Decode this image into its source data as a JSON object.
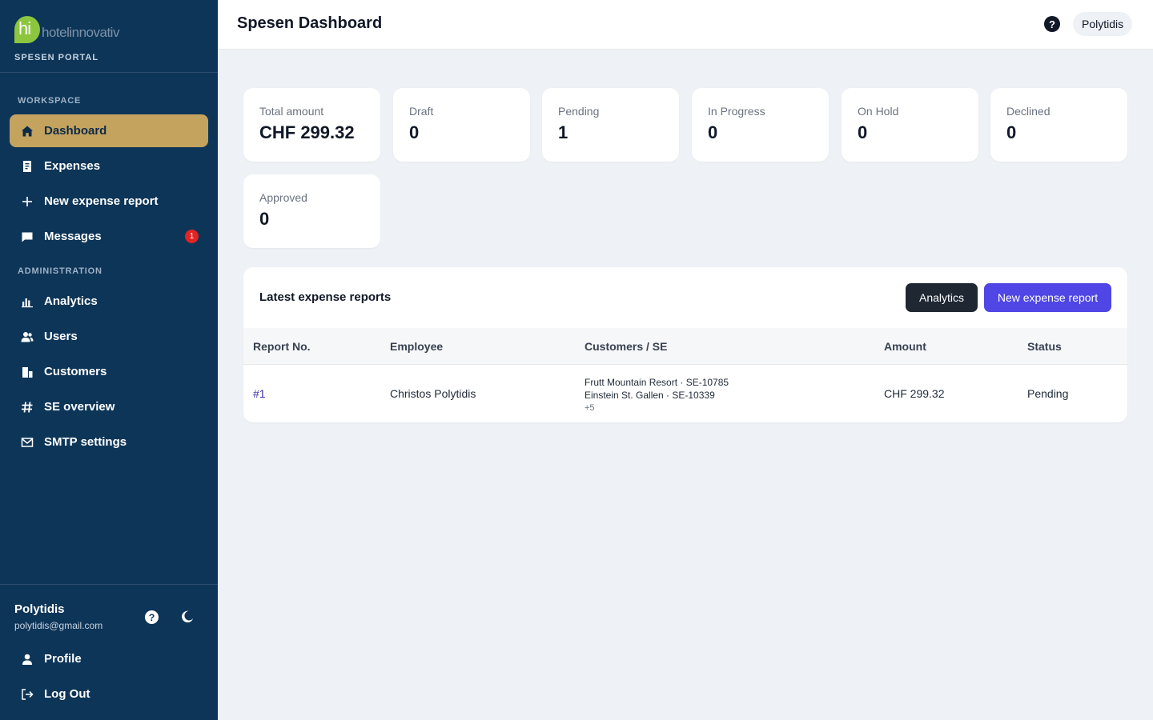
{
  "brand": {
    "logo_mark": "hi",
    "logo_text": "hotelinnovativ",
    "portal_label": "SPESEN PORTAL"
  },
  "sidebar": {
    "workspace_label": "WORKSPACE",
    "workspace_items": [
      {
        "label": "Dashboard",
        "icon": "home-icon",
        "active": true
      },
      {
        "label": "Expenses",
        "icon": "receipt-icon"
      },
      {
        "label": "New expense report",
        "icon": "plus-icon"
      },
      {
        "label": "Messages",
        "icon": "chat-icon",
        "badge": "1"
      }
    ],
    "admin_label": "ADMINISTRATION",
    "admin_items": [
      {
        "label": "Analytics",
        "icon": "bar-chart-icon"
      },
      {
        "label": "Users",
        "icon": "users-icon"
      },
      {
        "label": "Customers",
        "icon": "building-icon"
      },
      {
        "label": "SE overview",
        "icon": "hash-icon"
      },
      {
        "label": "SMTP settings",
        "icon": "mail-icon"
      }
    ]
  },
  "user": {
    "name": "Polytidis",
    "email": "polytidis@gmail.com",
    "profile_label": "Profile",
    "logout_label": "Log Out"
  },
  "header": {
    "title": "Spesen Dashboard",
    "help": "?",
    "user_pill": "Polytidis"
  },
  "stats": [
    {
      "label": "Total amount",
      "value": "CHF 299.32"
    },
    {
      "label": "Draft",
      "value": "0"
    },
    {
      "label": "Pending",
      "value": "1"
    },
    {
      "label": "In Progress",
      "value": "0"
    },
    {
      "label": "On Hold",
      "value": "0"
    },
    {
      "label": "Declined",
      "value": "0"
    },
    {
      "label": "Approved",
      "value": "0"
    }
  ],
  "reports": {
    "title": "Latest expense reports",
    "analytics_button": "Analytics",
    "new_button": "New expense report",
    "columns": [
      "Report No.",
      "Employee",
      "Customers / SE",
      "Amount",
      "Status"
    ],
    "rows": [
      {
        "report_no": "#1",
        "employee": "Christos Polytidis",
        "customers": [
          "Frutt Mountain Resort · SE-10785",
          "Einstein St. Gallen · SE-10339"
        ],
        "more": "+5",
        "amount": "CHF 299.32",
        "status": "Pending"
      }
    ]
  },
  "colors": {
    "sidebar": "#0d3558",
    "active": "#c4a35f",
    "primary": "#4f46e5",
    "dark_button": "#1f2733",
    "badge": "#e02424"
  }
}
